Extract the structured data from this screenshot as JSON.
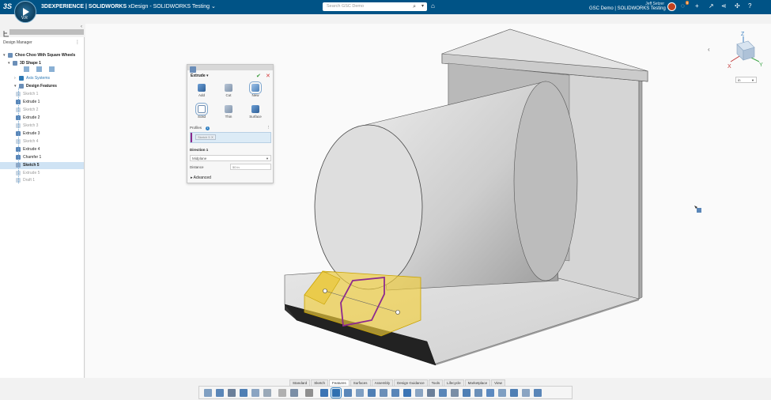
{
  "topbar": {
    "ds_logo": "3S",
    "compass_version": "V.R",
    "brand": "3DEXPERIENCE | SOLIDWORKS",
    "app": "xDesign - SOLIDWORKS Testing",
    "search_placeholder": "Search GSC Demo",
    "user_name": "Jeff Setzer",
    "context": "GSC Demo | SOLIDWORKS Testing",
    "notification_count": "9",
    "colors": {
      "bar": "#005386",
      "accent": "#2f7fc2"
    }
  },
  "design_manager": {
    "title": "Design Manager",
    "tree": [
      {
        "label": "Choo Choo With Square Wheels",
        "level": 0,
        "state": "bold"
      },
      {
        "label": "3D Shape 1",
        "level": 1,
        "state": "bold"
      },
      {
        "label": "Axis Systems",
        "level": 2,
        "state": "blue"
      },
      {
        "label": "Design Features",
        "level": 2,
        "state": "bold"
      },
      {
        "label": "Sketch 1",
        "level": 3,
        "state": "dim"
      },
      {
        "label": "Extrude 1",
        "level": 3,
        "state": "normal"
      },
      {
        "label": "Sketch 2",
        "level": 3,
        "state": "dim"
      },
      {
        "label": "Extrude 2",
        "level": 3,
        "state": "normal"
      },
      {
        "label": "Sketch 3",
        "level": 3,
        "state": "dim"
      },
      {
        "label": "Extrude 3",
        "level": 3,
        "state": "normal"
      },
      {
        "label": "Sketch 4",
        "level": 3,
        "state": "dim"
      },
      {
        "label": "Extrude 4",
        "level": 3,
        "state": "normal"
      },
      {
        "label": "Chamfer 1",
        "level": 3,
        "state": "normal"
      },
      {
        "label": "Sketch 5",
        "level": 3,
        "state": "selected"
      },
      {
        "label": "Extrude 5",
        "level": 3,
        "state": "dim"
      },
      {
        "label": "Draft 1",
        "level": 3,
        "state": "dim"
      }
    ]
  },
  "extrude_dialog": {
    "title": "Extrude",
    "ops": [
      {
        "label": "Add"
      },
      {
        "label": "Cut"
      },
      {
        "label": "New"
      }
    ],
    "types": [
      {
        "label": "Solid"
      },
      {
        "label": "Thin"
      },
      {
        "label": "Surface"
      }
    ],
    "profiles_label": "Profiles",
    "profiles_count": "1",
    "profile_chip": "Sketch 5",
    "direction_label": "Direction 1",
    "direction_value": "Midplane",
    "distance_label": "Distance",
    "distance_value": "50 in",
    "advanced_label": "Advanced"
  },
  "viewport": {
    "units": "in",
    "viewcube_axes": {
      "z": "Z",
      "x": "X",
      "y": "Y"
    }
  },
  "command_tabs": [
    "Standard",
    "Sketch",
    "Features",
    "Surfaces",
    "Assembly",
    "Design Guidance",
    "Tools",
    "Lifecycle",
    "Marketplace",
    "View"
  ],
  "active_tab": "Features"
}
